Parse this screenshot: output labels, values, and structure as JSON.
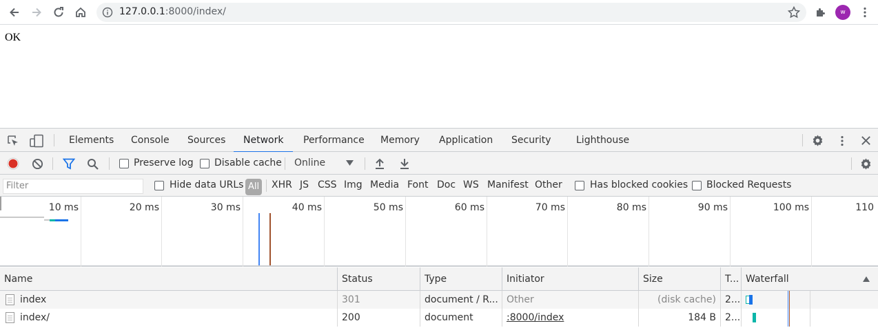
{
  "browser": {
    "url_host": "127.0.0.1",
    "url_path": ":8000/index/",
    "avatar_letter": "w",
    "avatar_color": "#9c27b0"
  },
  "page": {
    "body_text": "OK"
  },
  "devtools": {
    "tabs": [
      {
        "label": "Elements"
      },
      {
        "label": "Console"
      },
      {
        "label": "Sources"
      },
      {
        "label": "Network",
        "active": true
      },
      {
        "label": "Performance"
      },
      {
        "label": "Memory"
      },
      {
        "label": "Application"
      },
      {
        "label": "Security"
      },
      {
        "label": "Lighthouse"
      }
    ],
    "accent_color": "#1a73e8",
    "network": {
      "preserve_log": "Preserve log",
      "disable_cache": "Disable cache",
      "throttling": "Online",
      "filter_placeholder": "Filter",
      "hide_data_urls": "Hide data URLs",
      "type_filters": [
        "All",
        "XHR",
        "JS",
        "CSS",
        "Img",
        "Media",
        "Font",
        "Doc",
        "WS",
        "Manifest",
        "Other"
      ],
      "has_blocked_cookies": "Has blocked cookies",
      "blocked_requests": "Blocked Requests",
      "timeline_ticks": [
        "10 ms",
        "20 ms",
        "30 ms",
        "40 ms",
        "50 ms",
        "60 ms",
        "70 ms",
        "80 ms",
        "90 ms",
        "100 ms",
        "110"
      ],
      "columns": {
        "name": "Name",
        "status": "Status",
        "type": "Type",
        "initiator": "Initiator",
        "size": "Size",
        "time": "T...",
        "waterfall": "Waterfall"
      },
      "rows": [
        {
          "name": "index",
          "status": "301",
          "type": "document / R...",
          "initiator": "Other",
          "size": "(disk cache)",
          "time": "2..."
        },
        {
          "name": "index/",
          "status": "200",
          "type": "document",
          "initiator": ":8000/index",
          "size": "184 B",
          "time": "2..."
        }
      ]
    }
  }
}
